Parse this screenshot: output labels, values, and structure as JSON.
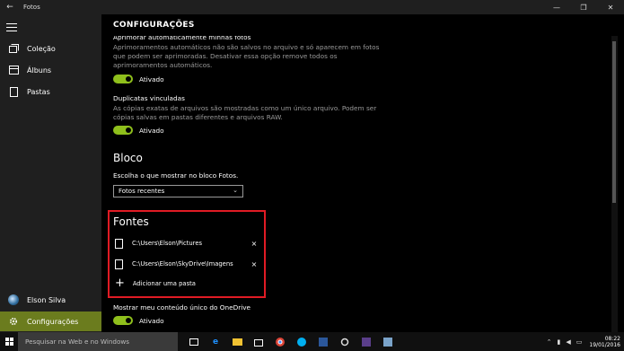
{
  "window": {
    "title": "Fotos",
    "back_glyph": "←",
    "minimize": "—",
    "maximize": "❐",
    "close": "✕"
  },
  "sidebar": {
    "items": [
      {
        "label": "Coleção",
        "icon": "collection-icon"
      },
      {
        "label": "Álbuns",
        "icon": "albums-icon"
      },
      {
        "label": "Pastas",
        "icon": "folders-icon"
      }
    ],
    "user": "Elson Silva",
    "settings": "Configurações"
  },
  "page": {
    "title": "CONFIGURAÇÕES"
  },
  "settings": {
    "enhance": {
      "title": "Aprimorar automaticamente minhas fotos",
      "desc1": "Aprimoramentos automáticos não são salvos no arquivo e só aparecem em fotos",
      "desc2": "que podem ser aprimoradas. Desativar essa opção remove todos os",
      "desc3": "aprimoramentos automáticos.",
      "state": "Ativado"
    },
    "duplicates": {
      "title": "Duplicatas vinculadas",
      "desc1": "As cópias exatas de arquivos são mostradas como um único arquivo. Podem ser",
      "desc2": "cópias salvas em pastas diferentes e arquivos RAW.",
      "state": "Ativado"
    },
    "tile": {
      "heading": "Bloco",
      "label": "Escolha o que mostrar no bloco Fotos.",
      "selected": "Fotos recentes"
    },
    "sources": {
      "heading": "Fontes",
      "paths": [
        "C:\\Users\\Elson\\Pictures",
        "C:\\Users\\Elson\\SkyDrive\\Imagens"
      ],
      "remove": "×",
      "add": "Adicionar uma pasta",
      "add_glyph": "+"
    },
    "onedrive": {
      "title": "Mostrar meu conteúdo único do OneDrive",
      "state": "Ativado"
    }
  },
  "taskbar": {
    "search_placeholder": "Pesquisar na Web e no Windows",
    "time": "08:22",
    "date": "19/01/2016",
    "colors": {
      "accent": "#6b7c1e",
      "toggle_on": "#8fbf1c",
      "highlight": "#e01b24"
    }
  }
}
